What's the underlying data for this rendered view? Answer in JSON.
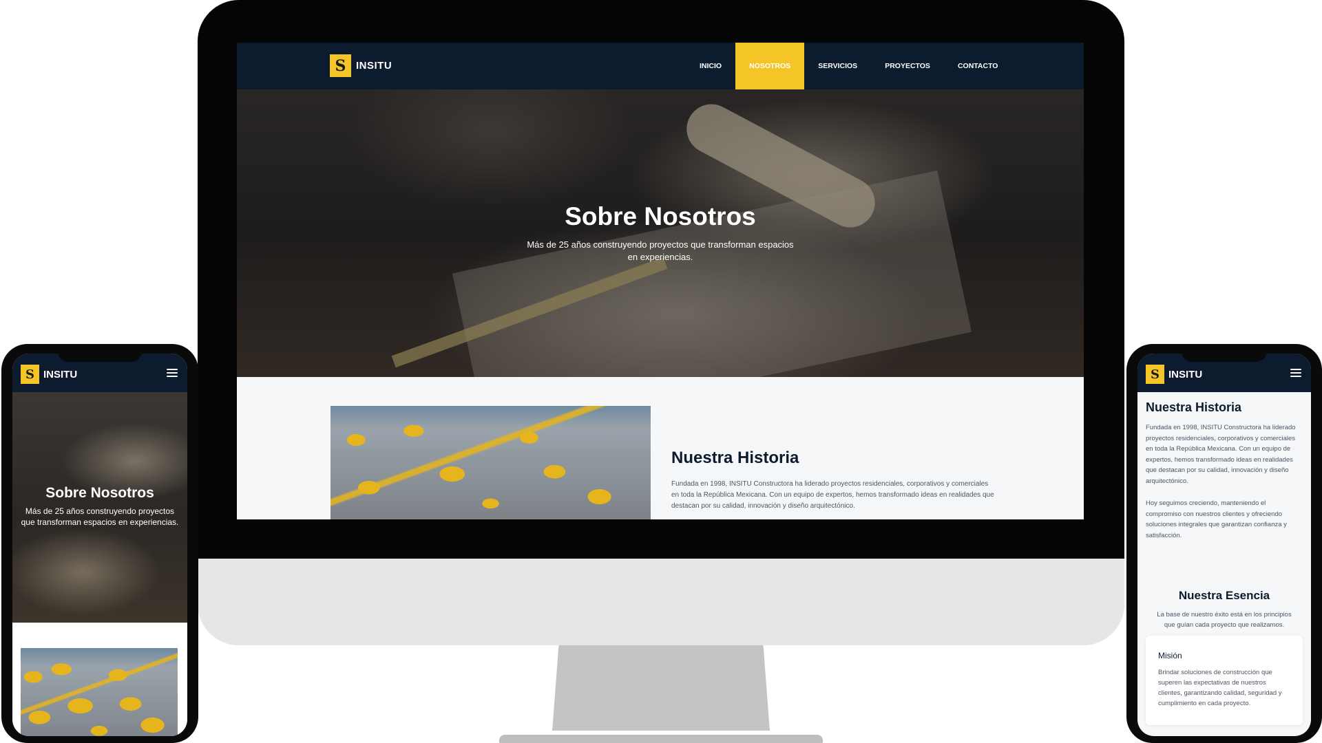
{
  "brand": {
    "name": "INSITU",
    "logo_letter": "S",
    "accent_color": "#f5c527",
    "navy_color": "#0d1b2e"
  },
  "nav": {
    "items": [
      {
        "label": "INICIO",
        "active": false
      },
      {
        "label": "NOSOTROS",
        "active": true
      },
      {
        "label": "SERVICIOS",
        "active": false
      },
      {
        "label": "PROYECTOS",
        "active": false
      },
      {
        "label": "CONTACTO",
        "active": false
      }
    ],
    "menu_icon": "hamburger-menu-icon"
  },
  "hero": {
    "title": "Sobre Nosotros",
    "subtitle": "Más de 25 años construyendo proyectos que transforman espacios en experiencias."
  },
  "historia": {
    "title": "Nuestra Historia",
    "paragraph1": "Fundada en 1998, INSITU Constructora ha liderado proyectos residenciales, corporativos y comerciales en toda la República Mexicana. Con un equipo de expertos, hemos transformado ideas en realidades que destacan por su calidad, innovación y diseño arquitectónico.",
    "paragraph2": "Hoy seguimos creciendo, manteniendo el compromiso con nuestros clientes y ofreciendo soluciones integrales que garantizan confianza y satisfacción."
  },
  "esencia": {
    "title": "Nuestra Esencia",
    "subtitle": "La base de nuestro éxito está en los principios que guían cada proyecto que realizamos.",
    "cards": [
      {
        "title": "Misión",
        "text": "Brindar soluciones de construcción que superen las expectativas de nuestros clientes, garantizando calidad, seguridad y cumplimiento en cada proyecto."
      }
    ]
  }
}
